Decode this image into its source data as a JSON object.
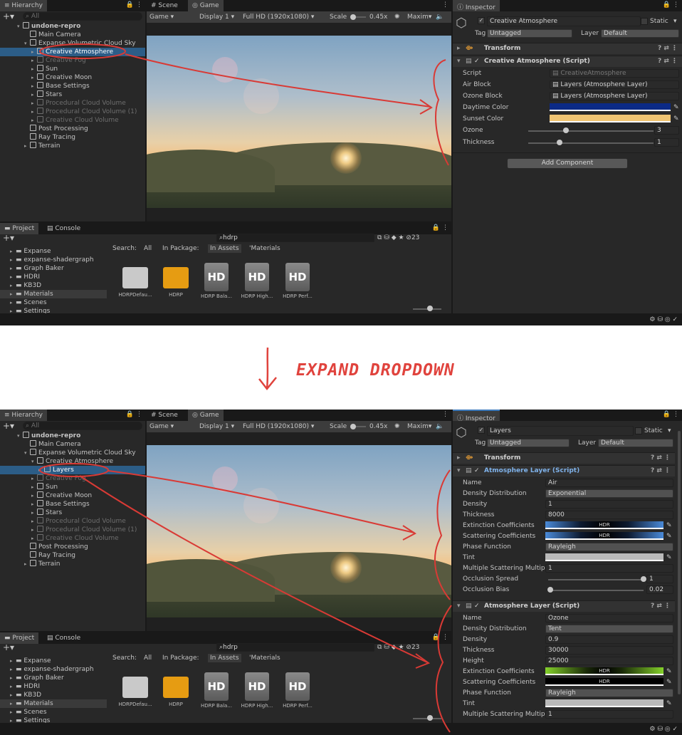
{
  "middle": {
    "caption": "EXPAND DROPDOWN"
  },
  "common": {
    "tabs": {
      "hierarchy": "Hierarchy",
      "scene": "Scene",
      "game": "Game",
      "inspector": "Inspector",
      "project": "Project",
      "console": "Console"
    },
    "search_placeholder": "All",
    "game_toolbar": {
      "mode": "Game",
      "display": "Display 1",
      "resolution": "Full HD (1920x1080)",
      "scale_label": "Scale",
      "scale_value": "0.45x",
      "maximize": "Maxim"
    },
    "project": {
      "search_value": "hdrp",
      "count": "23",
      "search_bar": {
        "label": "Search:",
        "all": "All",
        "in_package": "In Package:",
        "in_assets": "In Assets",
        "materials": "'Materials"
      },
      "tree": [
        "Expanse",
        "expanse-shadergraph",
        "Graph Baker",
        "HDRI",
        "KB3D",
        "Materials",
        "Scenes",
        "Settings"
      ],
      "assets": [
        "HDRPDefau...",
        "HDRP",
        "HDRP Bala...",
        "HDRP High...",
        "HDRP Perf..."
      ],
      "hd_text": "HD"
    }
  },
  "top": {
    "hierarchy": [
      {
        "label": "undone-repro",
        "indent": 0
      },
      {
        "label": "Main Camera",
        "indent": 1
      },
      {
        "label": "Expanse Volumetric Cloud Sky",
        "indent": 1
      },
      {
        "label": "Creative Atmosphere",
        "indent": 2,
        "selected": true
      },
      {
        "label": "Creative Fog",
        "indent": 2,
        "dim": true
      },
      {
        "label": "Sun",
        "indent": 2
      },
      {
        "label": "Creative Moon",
        "indent": 2
      },
      {
        "label": "Base Settings",
        "indent": 2
      },
      {
        "label": "Stars",
        "indent": 2
      },
      {
        "label": "Procedural Cloud Volume",
        "indent": 2,
        "dim": true
      },
      {
        "label": "Procedural Cloud Volume (1)",
        "indent": 2,
        "dim": true
      },
      {
        "label": "Creative Cloud Volume",
        "indent": 2,
        "dim": true
      },
      {
        "label": "Post Processing",
        "indent": 1
      },
      {
        "label": "Ray Tracing",
        "indent": 1
      },
      {
        "label": "Terrain",
        "indent": 1
      }
    ],
    "inspector": {
      "object_name": "Creative Atmosphere",
      "static_label": "Static",
      "tag_label": "Tag",
      "tag_value": "Untagged",
      "layer_label": "Layer",
      "layer_value": "Default",
      "transform_title": "Transform",
      "script_title": "Creative Atmosphere (Script)",
      "fields": {
        "script_label": "Script",
        "script_value": "CreativeAtmosphere",
        "air_label": "Air Block",
        "air_value": "Layers (Atmosphere Layer)",
        "ozone_block_label": "Ozone Block",
        "ozone_block_value": "Layers (Atmosphere Layer)",
        "daytime_label": "Daytime Color",
        "daytime_color": "#0b2a86",
        "sunset_label": "Sunset Color",
        "sunset_color": "#f0c472",
        "ozone_label": "Ozone",
        "ozone_value": "3",
        "thickness_label": "Thickness",
        "thickness_value": "1"
      },
      "add_component": "Add Component"
    }
  },
  "bottom": {
    "hierarchy": [
      {
        "label": "undone-repro",
        "indent": 0
      },
      {
        "label": "Main Camera",
        "indent": 1
      },
      {
        "label": "Expanse Volumetric Cloud Sky",
        "indent": 1
      },
      {
        "label": "Creative Atmosphere",
        "indent": 2
      },
      {
        "label": "Layers",
        "indent": 3,
        "selected": true
      },
      {
        "label": "Creative Fog",
        "indent": 2,
        "dim": true
      },
      {
        "label": "Sun",
        "indent": 2
      },
      {
        "label": "Creative Moon",
        "indent": 2
      },
      {
        "label": "Base Settings",
        "indent": 2
      },
      {
        "label": "Stars",
        "indent": 2
      },
      {
        "label": "Procedural Cloud Volume",
        "indent": 2,
        "dim": true
      },
      {
        "label": "Procedural Cloud Volume (1)",
        "indent": 2,
        "dim": true
      },
      {
        "label": "Creative Cloud Volume",
        "indent": 2,
        "dim": true
      },
      {
        "label": "Post Processing",
        "indent": 1
      },
      {
        "label": "Ray Tracing",
        "indent": 1
      },
      {
        "label": "Terrain",
        "indent": 1
      }
    ],
    "inspector": {
      "object_name": "Layers",
      "static_label": "Static",
      "tag_label": "Tag",
      "tag_value": "Untagged",
      "layer_label": "Layer",
      "layer_value": "Default",
      "transform_title": "Transform",
      "layer1": {
        "title": "Atmosphere Layer (Script)",
        "rows": [
          {
            "label": "Name",
            "value": "Air",
            "kind": "text"
          },
          {
            "label": "Density Distribution",
            "value": "Exponential",
            "kind": "drop"
          },
          {
            "label": "Density",
            "value": "1",
            "kind": "text"
          },
          {
            "label": "Thickness",
            "value": "8000",
            "kind": "text"
          },
          {
            "label": "Extinction Coefficients",
            "value": "HDR",
            "kind": "hdr-blue"
          },
          {
            "label": "Scattering Coefficients",
            "value": "HDR",
            "kind": "hdr-blue"
          },
          {
            "label": "Phase Function",
            "value": "Rayleigh",
            "kind": "drop"
          },
          {
            "label": "Tint",
            "value": "",
            "kind": "tint"
          },
          {
            "label": "Multiple Scattering Multipl",
            "value": "1",
            "kind": "text"
          },
          {
            "label": "Occlusion Spread",
            "value": "1",
            "kind": "slider",
            "pos": 1.0
          },
          {
            "label": "Occlusion Bias",
            "value": "0.02",
            "kind": "slider",
            "pos": 0.02
          }
        ]
      },
      "layer2": {
        "title": "Atmosphere Layer (Script)",
        "rows": [
          {
            "label": "Name",
            "value": "Ozone",
            "kind": "text"
          },
          {
            "label": "Density Distribution",
            "value": "Tent",
            "kind": "drop"
          },
          {
            "label": "Density",
            "value": "0.9",
            "kind": "text"
          },
          {
            "label": "Thickness",
            "value": "30000",
            "kind": "text"
          },
          {
            "label": "Height",
            "value": "25000",
            "kind": "text"
          },
          {
            "label": "Extinction Coefficients",
            "value": "HDR",
            "kind": "hdr-green"
          },
          {
            "label": "Scattering Coefficients",
            "value": "HDR",
            "kind": "hdr-dark"
          },
          {
            "label": "Phase Function",
            "value": "Rayleigh",
            "kind": "drop"
          },
          {
            "label": "Tint",
            "value": "",
            "kind": "tint"
          },
          {
            "label": "Multiple Scattering Multipl",
            "value": "1",
            "kind": "text"
          }
        ]
      }
    }
  }
}
